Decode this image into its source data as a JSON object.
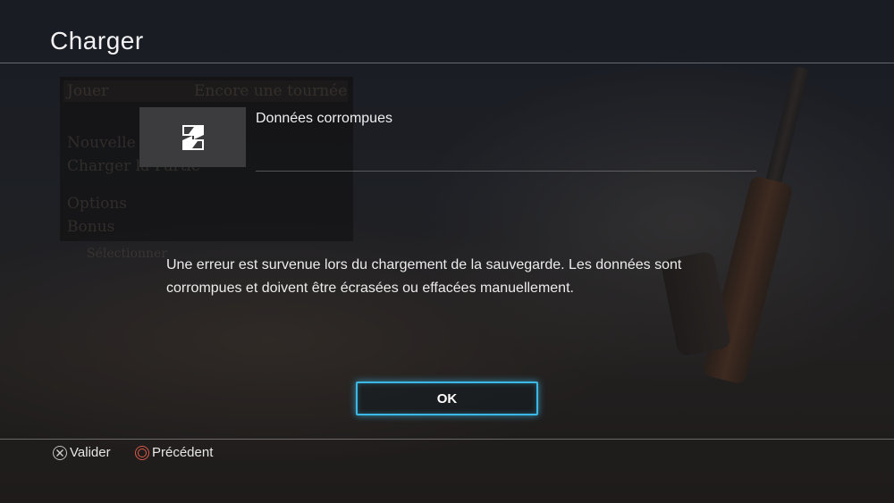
{
  "header": {
    "title": "Charger"
  },
  "background_menu": {
    "tab_left": "Jouer",
    "tab_right": "Encore une tournée",
    "items": [
      "Nouvelle Partie",
      "Charger la Partie",
      "Options",
      "Bonus"
    ],
    "hint": "Sélectionner"
  },
  "dialog": {
    "item_title": "Données corrompues",
    "message": "Une erreur est survenue lors du chargement de la sauvegarde. Les données sont corrompues et doivent être écrasées ou effacées manuellement.",
    "ok_label": "OK"
  },
  "footer": {
    "confirm_label": "Valider",
    "back_label": "Précédent"
  },
  "colors": {
    "accent": "#3bb8e6",
    "back_button": "#e05a48"
  },
  "icons": {
    "thumbnail": "corrupted-data-icon",
    "confirm": "cross-button-icon",
    "back": "circle-button-icon"
  }
}
